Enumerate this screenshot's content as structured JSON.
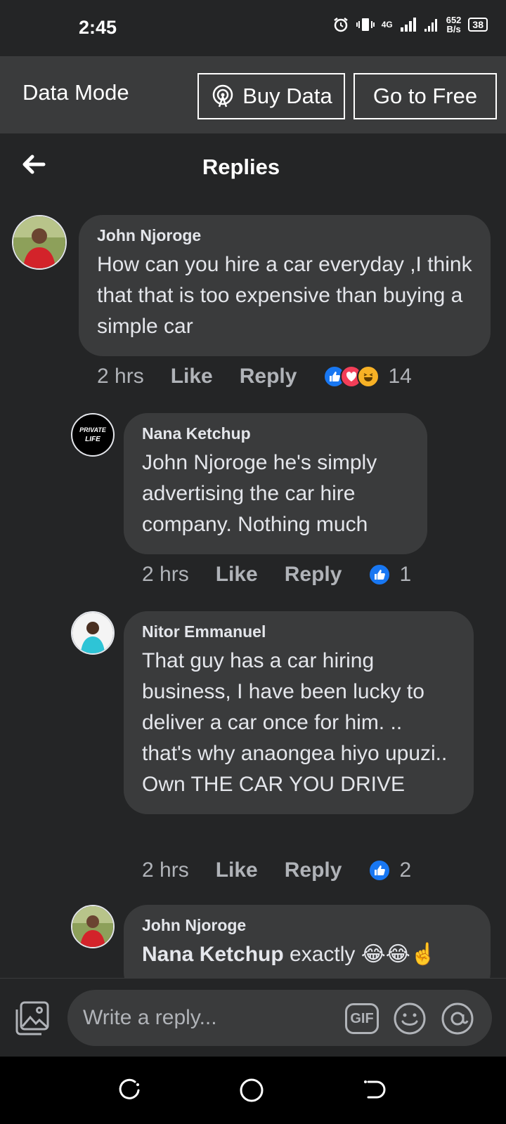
{
  "status_bar": {
    "time": "2:45",
    "network": "4G",
    "speed_value": "652",
    "speed_unit": "B/s",
    "battery": "38"
  },
  "data_mode": {
    "label": "Data Mode",
    "buy_label": "Buy Data",
    "free_label": "Go to Free"
  },
  "header": {
    "title": "Replies"
  },
  "comments": [
    {
      "name": "John Njoroge",
      "text": "How can you hire a car everyday ,I think that that is too expensive than buying a simple car",
      "time": "2 hrs",
      "like": "Like",
      "reply": "Reply",
      "reaction_count": "14"
    },
    {
      "name": "Nana Ketchup",
      "avatar_text_1": "PRIVATE",
      "avatar_text_2": "LIFE",
      "text": "John Njoroge he's simply advertising the car hire company. Nothing much",
      "time": "2 hrs",
      "like": "Like",
      "reply": "Reply",
      "reaction_count": "1"
    },
    {
      "name": "Nitor Emmanuel",
      "text": "That guy has a car hiring business, I have been lucky to deliver a car once for him. .. that's why anaongea hiyo upuzi.. Own THE CAR YOU DRIVE",
      "time": "2 hrs",
      "like": "Like",
      "reply": "Reply",
      "reaction_count": "2"
    },
    {
      "name": "John Njoroge",
      "mention": "Nana Ketchup",
      "text": " exactly 😂😂☝️"
    }
  ],
  "composer": {
    "placeholder": "Write a reply...",
    "gif_label": "GIF"
  },
  "colors": {
    "background": "#242526",
    "bubble": "#3a3b3c",
    "like_blue": "#1877f2",
    "love_red": "#f33e58"
  }
}
